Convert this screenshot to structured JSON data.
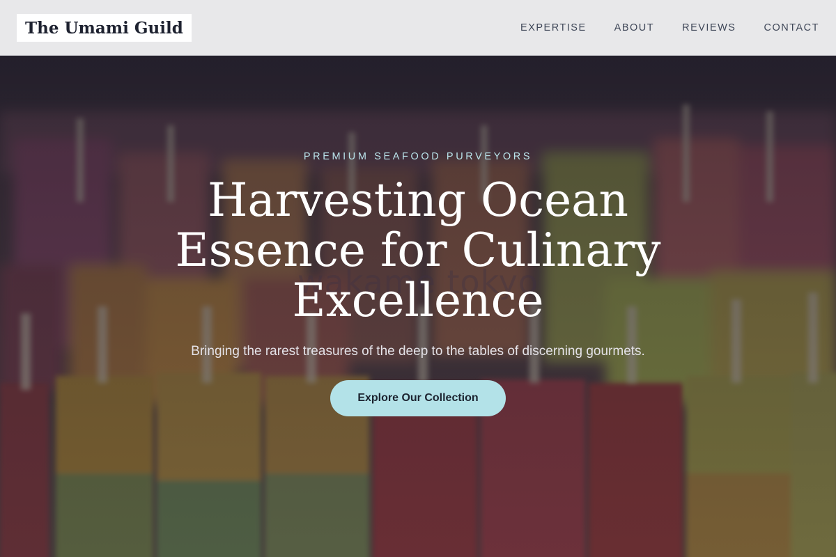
{
  "header": {
    "logo_text": "The Umami Guild",
    "nav": [
      {
        "label": "EXPERTISE"
      },
      {
        "label": "ABOUT"
      },
      {
        "label": "REVIEWS"
      },
      {
        "label": "CONTACT"
      }
    ]
  },
  "hero": {
    "eyebrow": "PREMIUM SEAFOOD PURVEYORS",
    "headline": "Harvesting Ocean Essence for Culinary Excellence",
    "subtitle": "Bringing the rarest treasures of the deep to the tables of discerning gourmets.",
    "cta_label": "Explore Our Collection",
    "background_watermark": "wakame tokyo"
  },
  "colors": {
    "header_bg": "#e8e8ea",
    "logo_bg": "#ffffff",
    "nav_text": "#3f4758",
    "eyebrow": "#b9e3ea",
    "cta_bg": "#b3e2e8",
    "cta_text": "#1c2430"
  }
}
